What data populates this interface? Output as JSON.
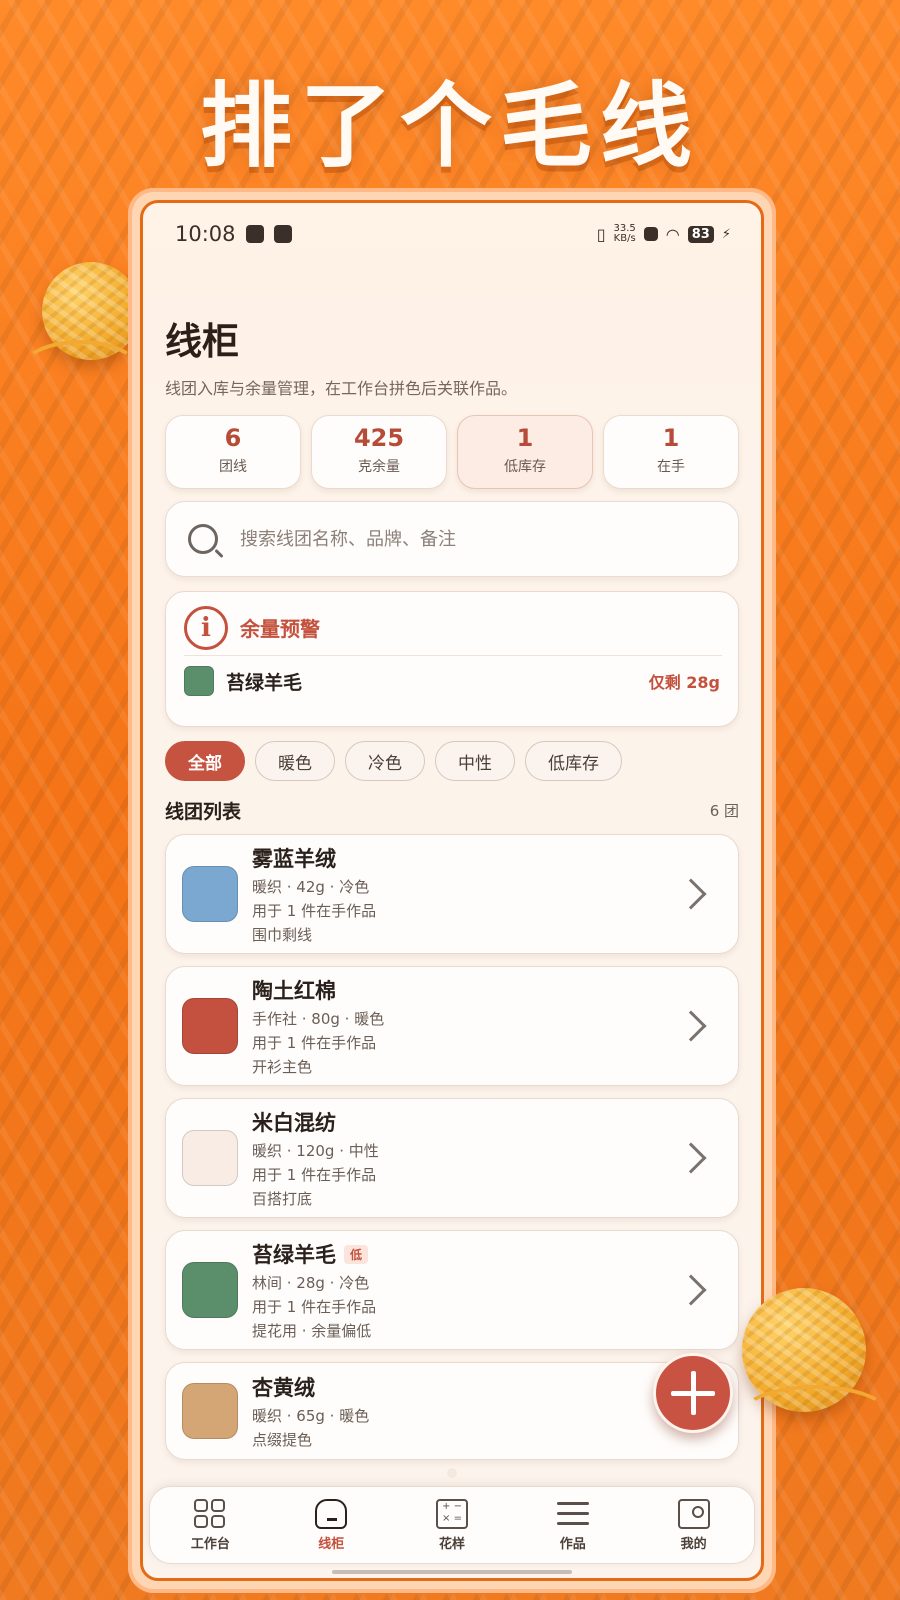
{
  "banner": {
    "title": "排了个毛线"
  },
  "statusbar": {
    "time": "10:08",
    "net_speed": "33.5",
    "net_unit": "KB/s",
    "battery": "83"
  },
  "page": {
    "title": "线柜",
    "subtitle": "线团入库与余量管理，在工作台拼色后关联作品。"
  },
  "stats": [
    {
      "value": "6",
      "label": "团线"
    },
    {
      "value": "425",
      "label": "克余量"
    },
    {
      "value": "1",
      "label": "低库存"
    },
    {
      "value": "1",
      "label": "在手"
    }
  ],
  "search": {
    "placeholder": "搜索线团名称、品牌、备注"
  },
  "alert": {
    "title": "余量预警",
    "item_name": "苔绿羊毛",
    "item_color": "#5b8e6b",
    "remain": "仅剩 28g"
  },
  "filters": [
    {
      "label": "全部",
      "active": true
    },
    {
      "label": "暖色"
    },
    {
      "label": "冷色"
    },
    {
      "label": "中性"
    },
    {
      "label": "低库存"
    }
  ],
  "list": {
    "title": "线团列表",
    "count": "6 团",
    "items": [
      {
        "name": "雾蓝羊绒",
        "color": "#7aa8d0",
        "meta": "暖织 · 42g · 冷色",
        "usage": "用于 1 件在手作品",
        "note": "围巾剩线"
      },
      {
        "name": "陶土红棉",
        "color": "#c4513f",
        "meta": "手作社 · 80g · 暖色",
        "usage": "用于 1 件在手作品",
        "note": "开衫主色"
      },
      {
        "name": "米白混纺",
        "color": "#f8ece4",
        "meta": "暖织 · 120g · 中性",
        "usage": "用于 1 件在手作品",
        "note": "百搭打底"
      },
      {
        "name": "苔绿羊毛",
        "color": "#5b8e6b",
        "tag": "低",
        "meta": "林间 · 28g · 冷色",
        "usage": "用于 1 件在手作品",
        "note": "提花用 · 余量偏低"
      },
      {
        "name": "杏黄绒",
        "color": "#d5a675",
        "meta": "暖织 · 65g · 暖色",
        "usage": "点缀提色"
      }
    ]
  },
  "tabs": [
    {
      "label": "工作台",
      "icon": "grid-icon"
    },
    {
      "label": "线柜",
      "icon": "home-icon",
      "active": true
    },
    {
      "label": "花样",
      "icon": "calculator-icon"
    },
    {
      "label": "作品",
      "icon": "menu-icon"
    },
    {
      "label": "我的",
      "icon": "profile-card-icon"
    }
  ],
  "colors": {
    "accent": "#c4513d",
    "background_orange": "#f47a1c"
  }
}
